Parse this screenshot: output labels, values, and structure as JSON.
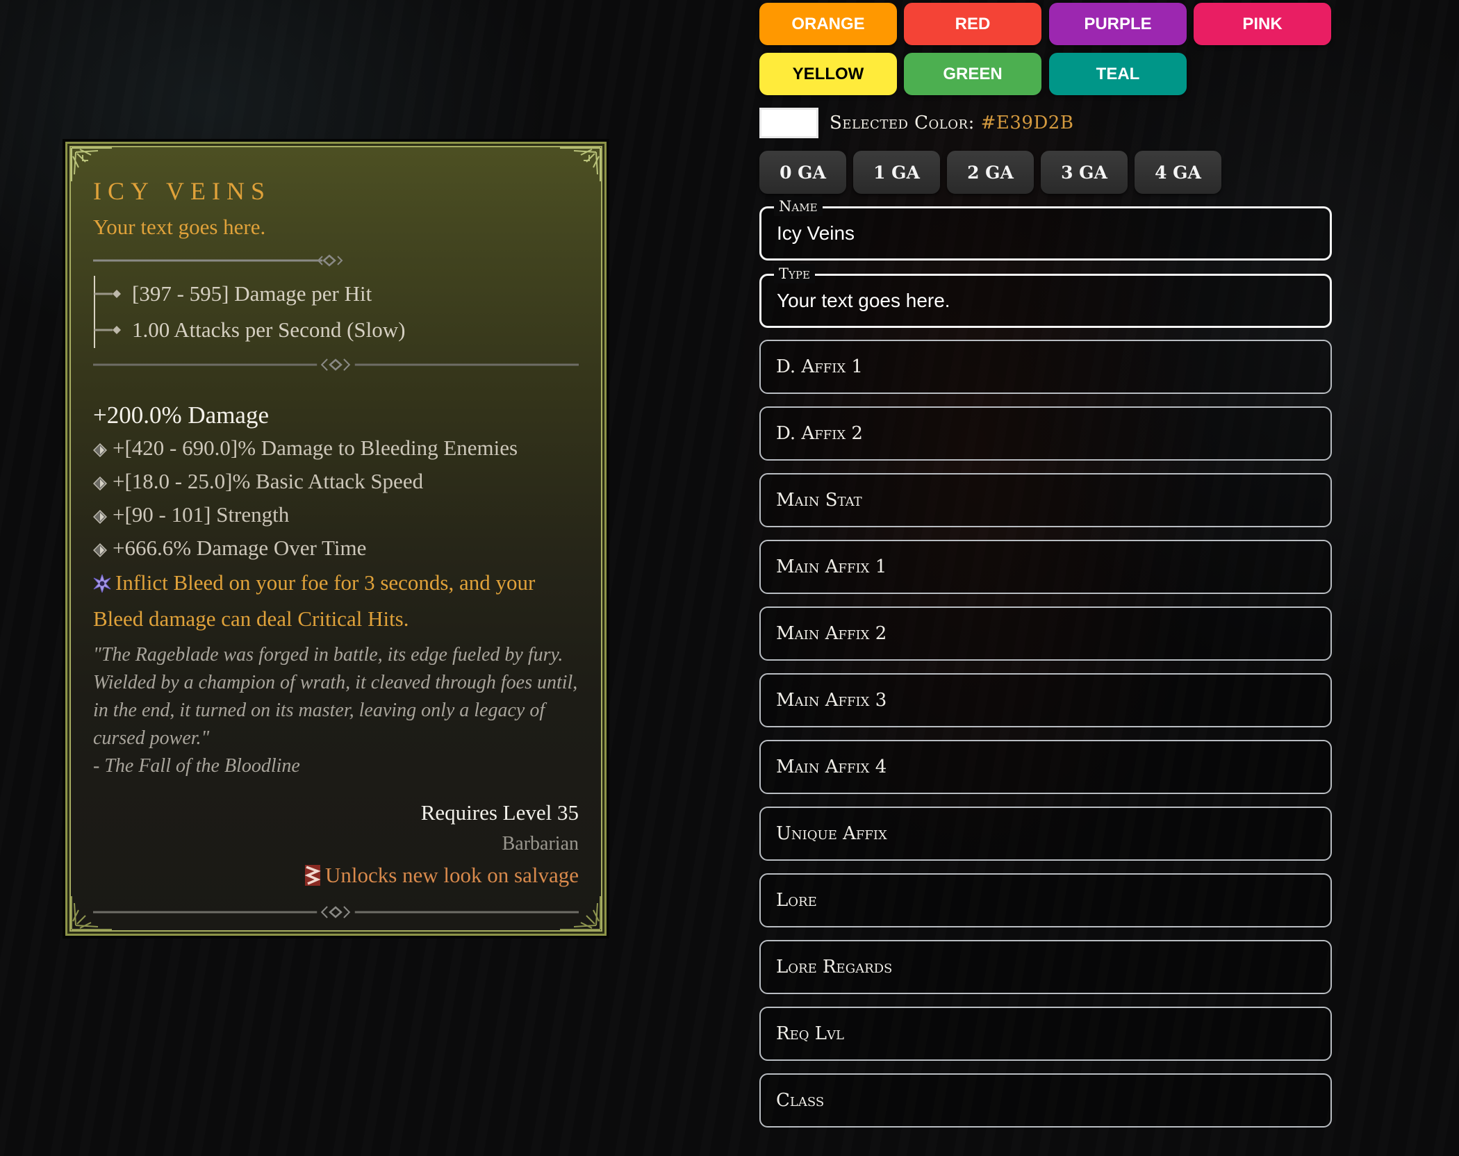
{
  "item_card": {
    "name": "ICY VEINS",
    "type": "Your text goes here.",
    "base_stats": [
      "[397 - 595] Damage per Hit",
      "1.00 Attacks per Second (Slow)"
    ],
    "main_stat": "+200.0% Damage",
    "affixes": [
      "+[420 - 690.0]% Damage to Bleeding Enemies",
      "+[18.0 - 25.0]% Basic Attack Speed",
      "+[90 - 101] Strength",
      "+666.6% Damage Over Time"
    ],
    "unique_affix": "Inflict Bleed on your foe for 3 seconds, and your Bleed damage can deal Critical Hits.",
    "lore": "\"The Rageblade was forged in battle, its edge fueled by fury. Wielded by a champion of wrath, it cleaved through foes until, in the end, it turned on its master, leaving only a legacy of cursed power.\"",
    "lore_source": "- The Fall of the Bloodline",
    "requires_level": "Requires Level 35",
    "class": "Barbarian",
    "salvage_note": "Unlocks new look on salvage",
    "icons": {
      "unique": "unique-star-icon",
      "salvage": "transmog-salvage-icon",
      "bullet": "diamond-bullet-icon"
    },
    "colors": {
      "name": "#e0a23a",
      "unique": "#e0a23a",
      "salvage": "#d98a4c",
      "lore": "#a9a59c",
      "frame": "#8d9448"
    }
  },
  "color_buttons": [
    {
      "label": "ORANGE",
      "color": "#ff9800",
      "text_color": "#ffffff"
    },
    {
      "label": "RED",
      "color": "#f44336",
      "text_color": "#ffffff"
    },
    {
      "label": "PURPLE",
      "color": "#9c27b0",
      "text_color": "#ffffff"
    },
    {
      "label": "PINK",
      "color": "#e91e63",
      "text_color": "#ffffff"
    },
    {
      "label": "YELLOW",
      "color": "#ffeb3b",
      "text_color": "#000000"
    },
    {
      "label": "GREEN",
      "color": "#4caf50",
      "text_color": "#ffffff"
    },
    {
      "label": "TEAL",
      "color": "#009688",
      "text_color": "#ffffff"
    }
  ],
  "selected_color": {
    "label": "Selected Color:",
    "value": "#E39D2B",
    "swatch": "#ffffff"
  },
  "ga_buttons": [
    "0 GA",
    "1 GA",
    "2 GA",
    "3 GA",
    "4 GA"
  ],
  "fields": [
    {
      "id": "name",
      "legend": "Name",
      "value": "Icy Veins",
      "placeholder": ""
    },
    {
      "id": "type",
      "legend": "Type",
      "value": "Your text goes here.",
      "placeholder": ""
    },
    {
      "id": "d-affix-1",
      "legend": "",
      "value": "",
      "placeholder": "D. Affix 1"
    },
    {
      "id": "d-affix-2",
      "legend": "",
      "value": "",
      "placeholder": "D. Affix 2"
    },
    {
      "id": "main-stat",
      "legend": "",
      "value": "",
      "placeholder": "Main Stat"
    },
    {
      "id": "main-affix-1",
      "legend": "",
      "value": "",
      "placeholder": "Main Affix 1"
    },
    {
      "id": "main-affix-2",
      "legend": "",
      "value": "",
      "placeholder": "Main Affix 2"
    },
    {
      "id": "main-affix-3",
      "legend": "",
      "value": "",
      "placeholder": "Main Affix 3"
    },
    {
      "id": "main-affix-4",
      "legend": "",
      "value": "",
      "placeholder": "Main Affix 4"
    },
    {
      "id": "unique-affix",
      "legend": "",
      "value": "",
      "placeholder": "Unique Affix"
    },
    {
      "id": "lore",
      "legend": "",
      "value": "",
      "placeholder": "Lore"
    },
    {
      "id": "lore-regards",
      "legend": "",
      "value": "",
      "placeholder": "Lore Regards"
    },
    {
      "id": "req-lvl",
      "legend": "",
      "value": "",
      "placeholder": "Req Lvl"
    },
    {
      "id": "class",
      "legend": "",
      "value": "",
      "placeholder": "Class"
    }
  ]
}
